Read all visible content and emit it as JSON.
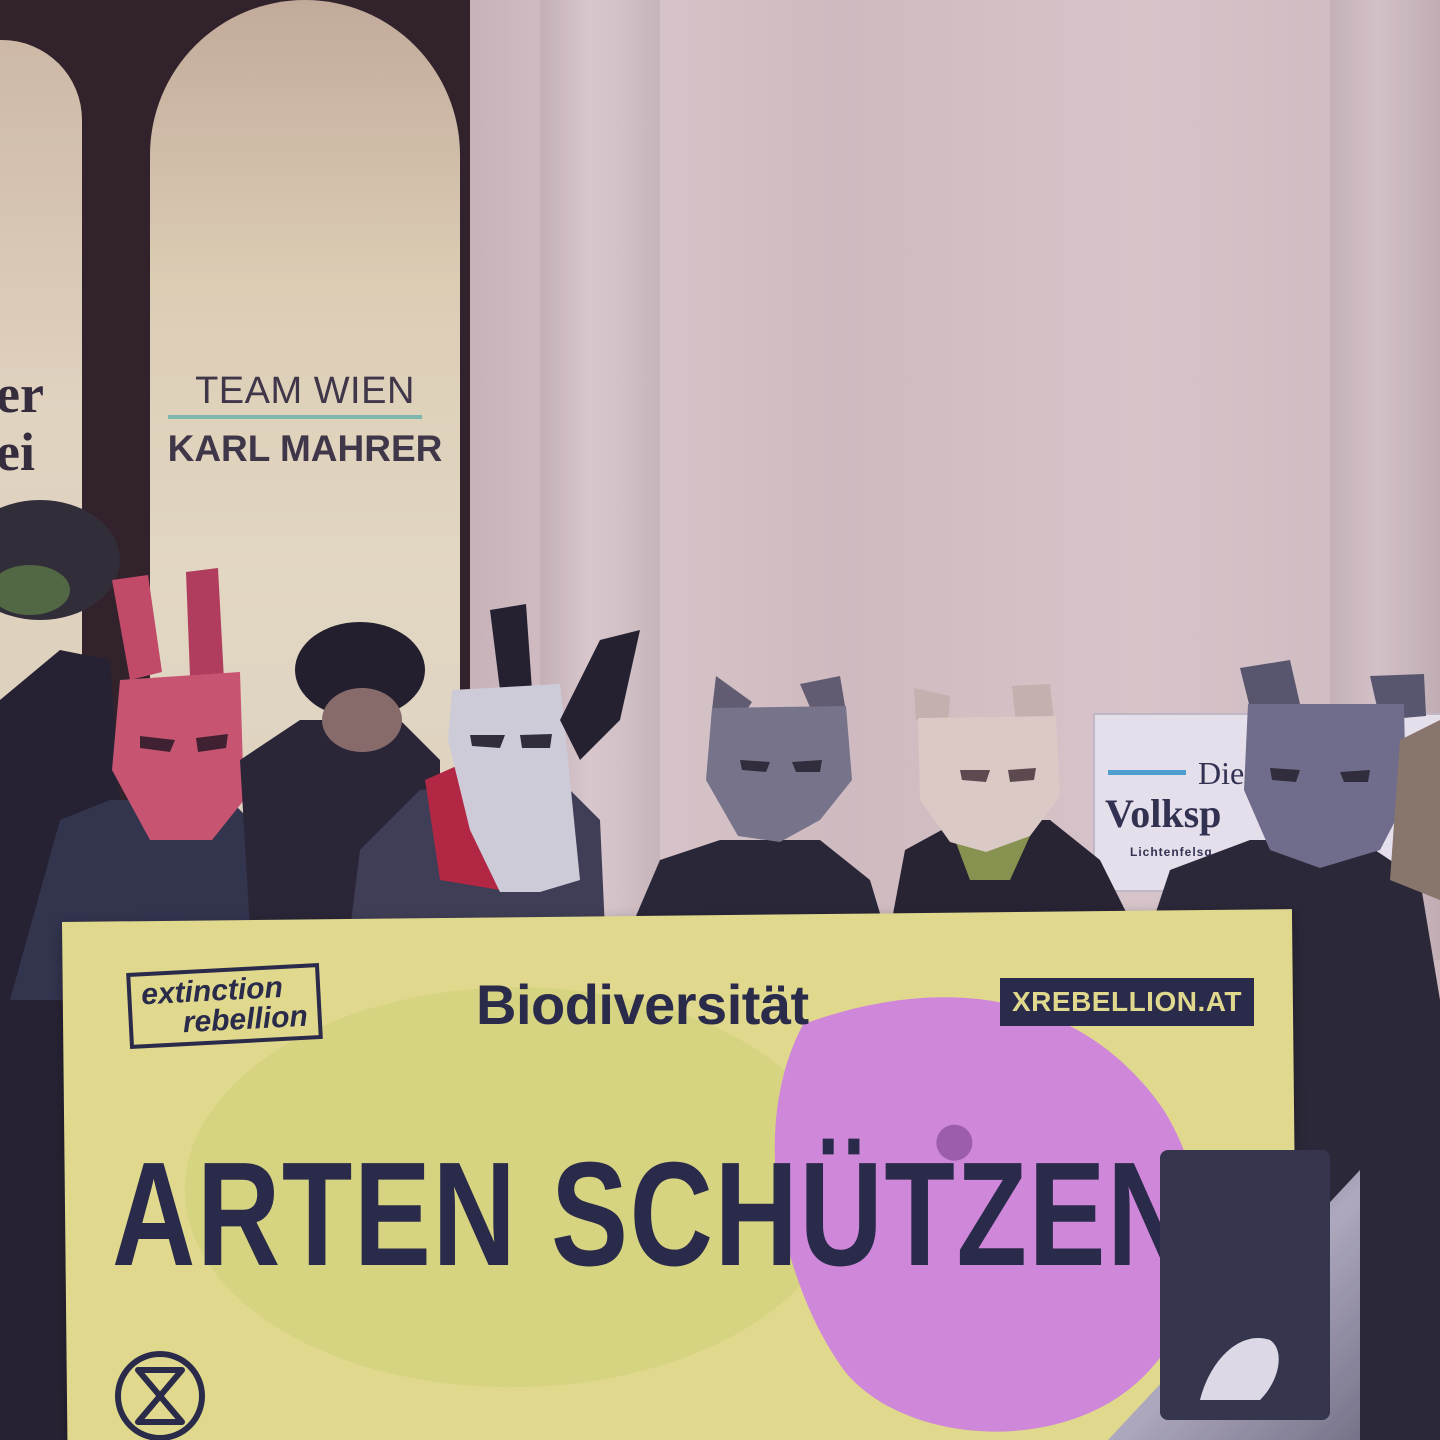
{
  "window_sign": {
    "title": "TEAM WIEN",
    "name": "KARL MAHRER",
    "fragment_line1": "er",
    "fragment_line2": "ei"
  },
  "door_plaque": {
    "die": "Die",
    "party": "Volksp",
    "address": "Lichtenfelsg"
  },
  "banner": {
    "logo_line1": "extinction",
    "logo_line2": "rebellion",
    "url": "XREBELLION.AT",
    "headline_small": "Biodiversität",
    "headline_big": "ARTEN SCHÜTZEN"
  },
  "colors": {
    "banner_yellow": "#ece98c",
    "banner_navy": "#222642",
    "banner_pink": "#d88ee0",
    "sign_accent": "#7fc3b0",
    "plaque_accent": "#4aa8d6"
  },
  "masks": [
    "rabbit-mask",
    "horse-mask",
    "wolf-mask",
    "bear-mask",
    "mouse-mask"
  ]
}
